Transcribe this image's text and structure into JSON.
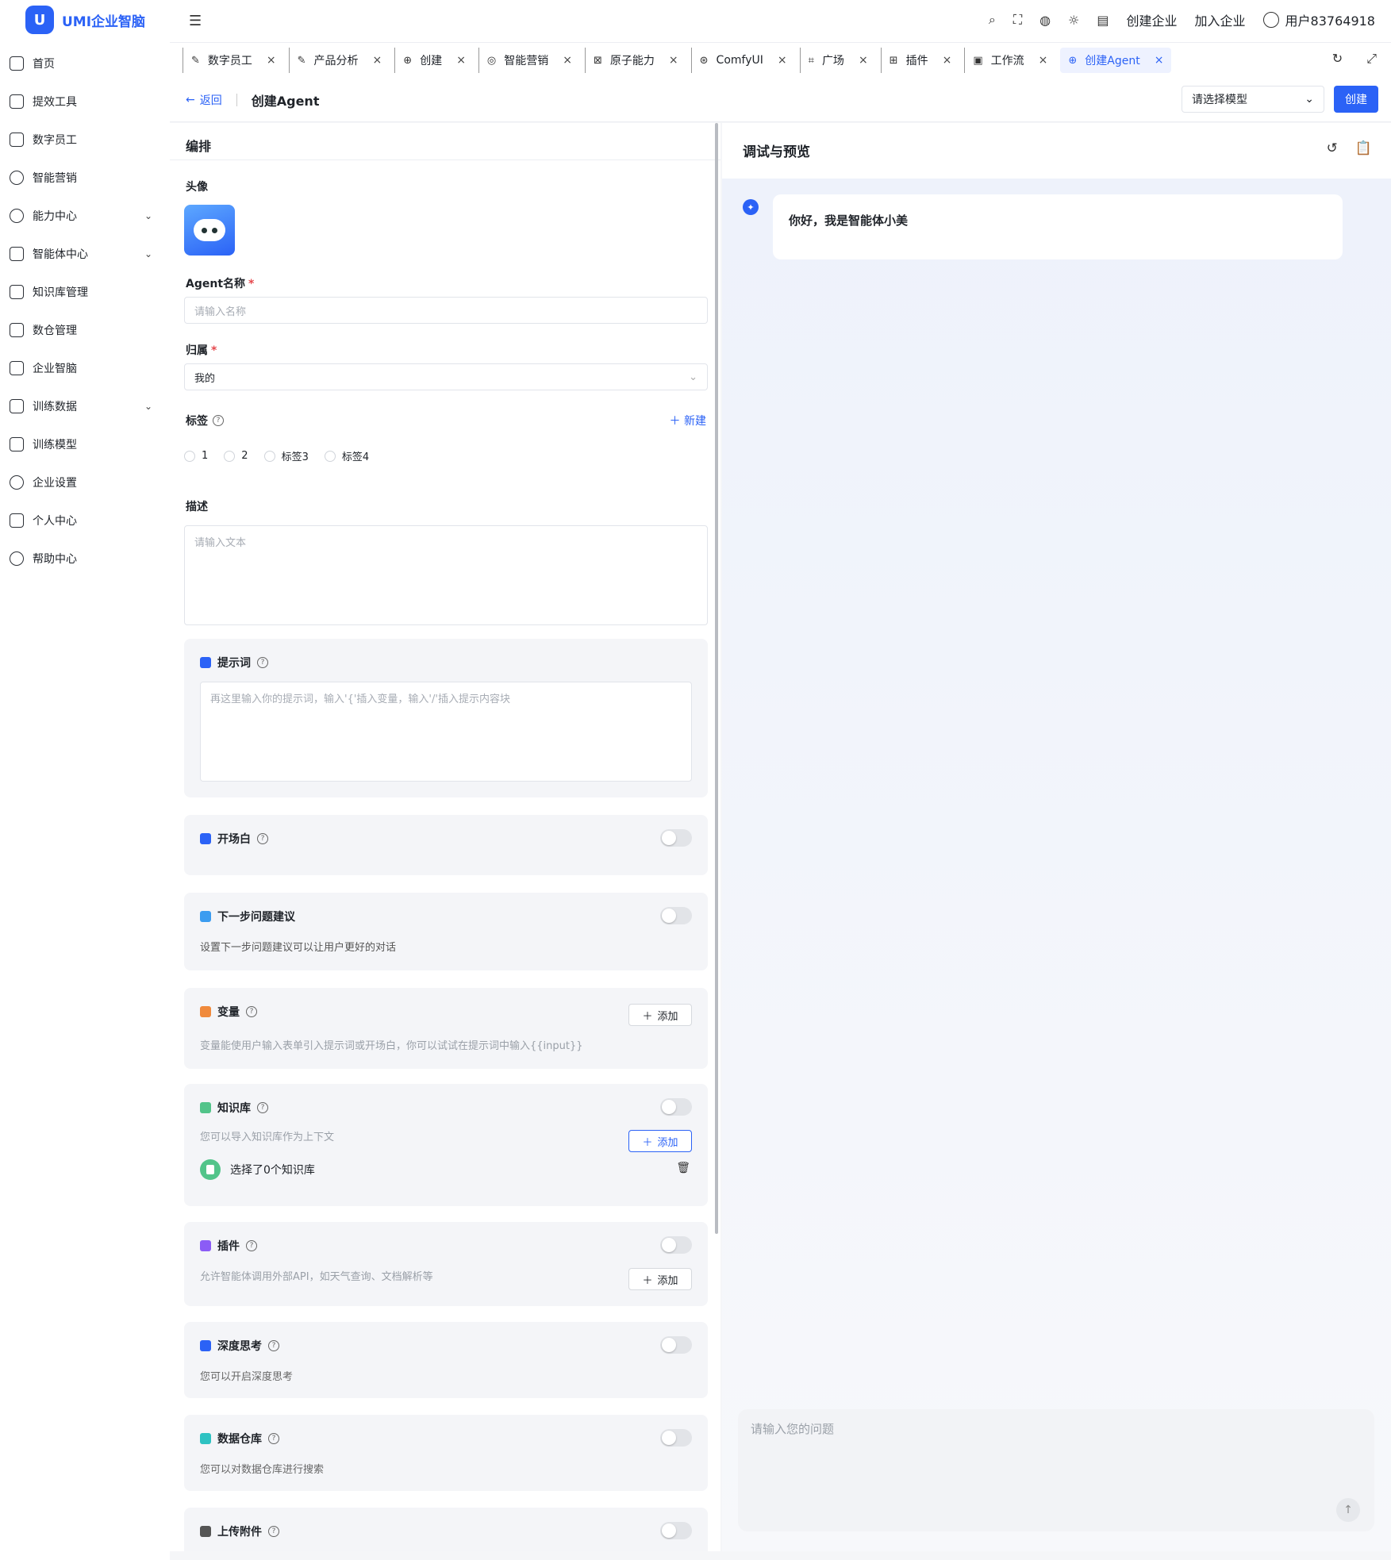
{
  "logo": {
    "mark": "U",
    "text": "UMI企业智脑"
  },
  "sidebar": {
    "items": [
      {
        "label": "首页",
        "icon": "home-icon"
      },
      {
        "label": "提效工具",
        "icon": "chart-icon"
      },
      {
        "label": "数字员工",
        "icon": "user-badge-icon"
      },
      {
        "label": "智能营销",
        "icon": "target-icon"
      },
      {
        "label": "能力中心",
        "icon": "ability-icon",
        "expandable": true
      },
      {
        "label": "智能体中心",
        "icon": "robot-icon",
        "expandable": true
      },
      {
        "label": "知识库管理",
        "icon": "book-icon"
      },
      {
        "label": "数仓管理",
        "icon": "database-icon"
      },
      {
        "label": "企业智脑",
        "icon": "brain-icon"
      },
      {
        "label": "训练数据",
        "icon": "data-icon",
        "expandable": true
      },
      {
        "label": "训练模型",
        "icon": "model-icon"
      },
      {
        "label": "企业设置",
        "icon": "settings-icon"
      },
      {
        "label": "个人中心",
        "icon": "person-icon"
      },
      {
        "label": "帮助中心",
        "icon": "help-icon"
      }
    ]
  },
  "topbar": {
    "create_company": "创建企业",
    "join_company": "加入企业",
    "username": "用户83764918"
  },
  "tabs": [
    {
      "label": "数字员工",
      "icon": "✎"
    },
    {
      "label": "产品分析",
      "icon": "✎"
    },
    {
      "label": "创建",
      "icon": "⊕"
    },
    {
      "label": "智能营销",
      "icon": "◎"
    },
    {
      "label": "原子能力",
      "icon": "⊠"
    },
    {
      "label": "ComfyUI",
      "icon": "⊛"
    },
    {
      "label": "广场",
      "icon": "⌗"
    },
    {
      "label": "插件",
      "icon": "⊞"
    },
    {
      "label": "工作流",
      "icon": "▣"
    },
    {
      "label": "创建Agent",
      "icon": "⊕",
      "active": true
    }
  ],
  "page": {
    "back": "返回",
    "title": "创建Agent",
    "model_placeholder": "请选择模型",
    "create": "创建"
  },
  "editor": {
    "title": "编排",
    "avatar_label": "头像",
    "name_label": "Agent名称",
    "name_placeholder": "请输入名称",
    "owner_label": "归属",
    "owner_value": "我的",
    "tag_label": "标签",
    "new_tag": "新建",
    "tags": [
      "1",
      "2",
      "标签3",
      "标签4"
    ],
    "desc_label": "描述",
    "desc_placeholder": "请输入文本",
    "prompt": {
      "title": "提示词",
      "placeholder": "再这里输入你的提示词，输入'{'插入变量，输入'/'插入提示内容块"
    },
    "opening": {
      "title": "开场白"
    },
    "next_step": {
      "title": "下一步问题建议",
      "desc": "设置下一步问题建议可以让用户更好的对话"
    },
    "variables": {
      "title": "变量",
      "add": "添加",
      "desc": "变量能使用户输入表单引入提示词或开场白，你可以试试在提示词中输入{{input}}"
    },
    "knowledge": {
      "title": "知识库",
      "desc": "您可以导入知识库作为上下文",
      "add": "添加",
      "selected": "选择了0个知识库"
    },
    "plugins": {
      "title": "插件",
      "desc": "允许智能体调用外部API，如天气查询、文档解析等",
      "add": "添加"
    },
    "deep_think": {
      "title": "深度思考",
      "desc": "您可以开启深度思考"
    },
    "warehouse": {
      "title": "数据仓库",
      "desc": "您可以对数据仓库进行搜索"
    },
    "upload": {
      "title": "上传附件"
    }
  },
  "preview": {
    "title": "调试与预览",
    "greeting": "你好，我是智能体小美",
    "input_placeholder": "请输入您的问题"
  },
  "colors": {
    "accent": "#2b62f6",
    "card_bg": "#f4f5f8"
  }
}
